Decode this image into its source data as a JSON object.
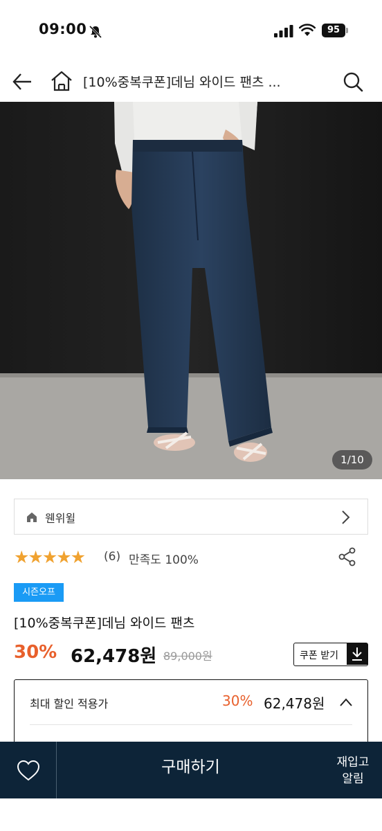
{
  "status_bar": {
    "time": "09:00",
    "battery": "95"
  },
  "header": {
    "title": "[10%중복쿠폰]데님 와이드 팬츠 ..."
  },
  "gallery": {
    "counter": "1/10"
  },
  "brand": {
    "name": "웬위윌"
  },
  "rating": {
    "stars": "★★★★★",
    "review_count": "(6)",
    "satisfaction": "만족도 100%"
  },
  "product": {
    "badge": "시즌오프",
    "name": "[10%중복쿠폰]데님 와이드 팬츠",
    "discount": "30%",
    "price": "62,478원",
    "original_price": "89,000원",
    "coupon_label": "쿠폰 받기"
  },
  "max_discount": {
    "label": "최대 할인 적용가",
    "discount": "30%",
    "price": "62,478원"
  },
  "bottom_bar": {
    "buy_label": "구매하기",
    "restock_line1": "재입고",
    "restock_line2": "알림"
  },
  "colors": {
    "accent_discount": "#e8602c",
    "star": "#f0a230",
    "badge": "#1a9bf5",
    "bottom_bar": "#0d2438"
  }
}
